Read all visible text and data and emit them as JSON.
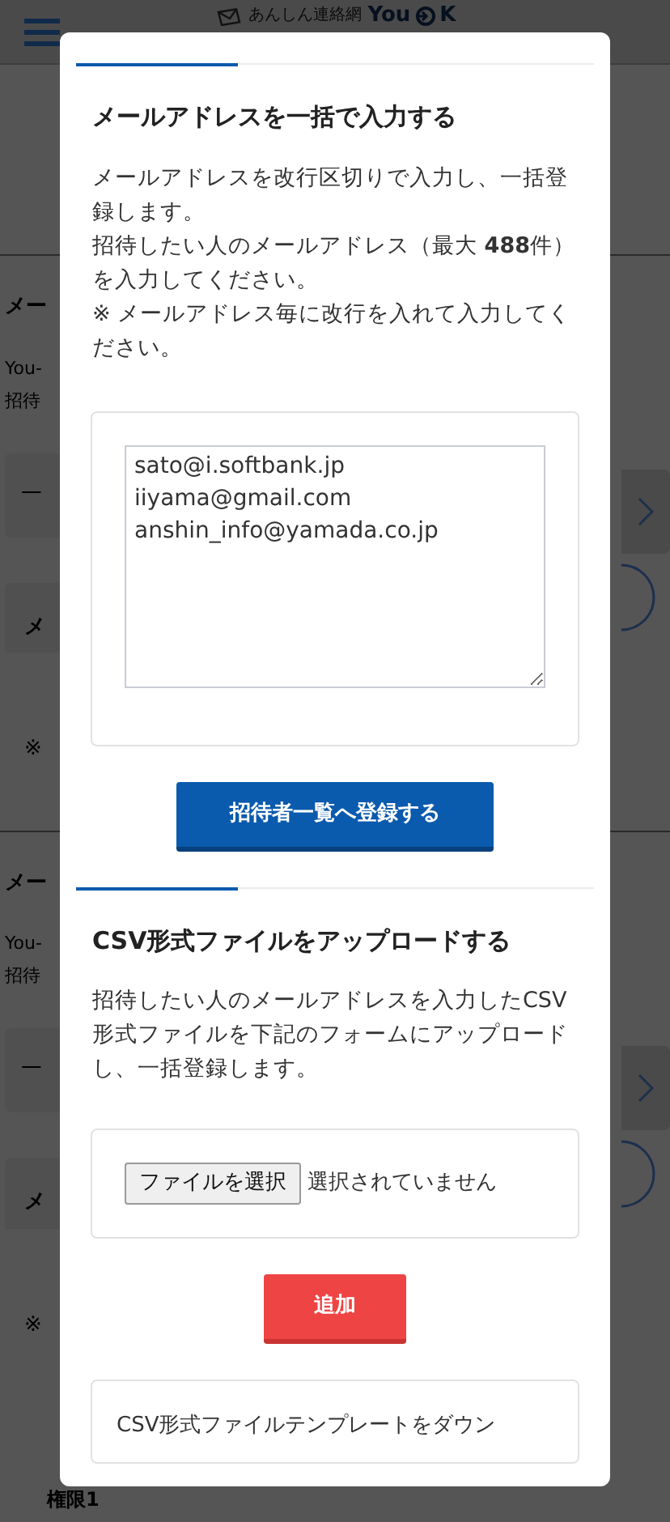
{
  "header": {
    "logo_text": "あんしん連絡網",
    "brand_left": "You",
    "brand_right": "K"
  },
  "background_sections": [
    {
      "heading": "メー",
      "lines": [
        "You-",
        "招待"
      ],
      "select_text": "一",
      "field_label": "メ",
      "note": "※"
    },
    {
      "heading": "メー",
      "lines": [
        "You-",
        "招待"
      ],
      "select_text": "一",
      "field_label": "メ",
      "note": "※",
      "extra_label": "権限1"
    }
  ],
  "modal": {
    "sections": [
      {
        "kind": "textarea",
        "heading": "メールアドレスを一括で入力する",
        "paragraphs": [
          "メールアドレスを改行区切りで入力し、一括登録します。",
          "招待したい人のメールアドレス（最大 **488**件）を入力してください。",
          "※ メールアドレス毎に改行を入れて入力してください。"
        ],
        "value": "sato@i.softbank.jp\niiyama@gmail.com\nanshin_info@yamada.co.jp",
        "button": "招待者一覧へ登録する"
      },
      {
        "kind": "file",
        "heading": "CSV形式ファイルをアップロードする",
        "paragraphs": [
          "招待したい人のメールアドレスを入力したCSV形式ファイルを下記のフォームにアップロードし、一括登録します。"
        ],
        "file_button": "ファイルを選択",
        "file_status": "選択されていません",
        "button": "追加"
      }
    ],
    "download_card": "CSV形式ファイルテンプレートをダウン"
  }
}
